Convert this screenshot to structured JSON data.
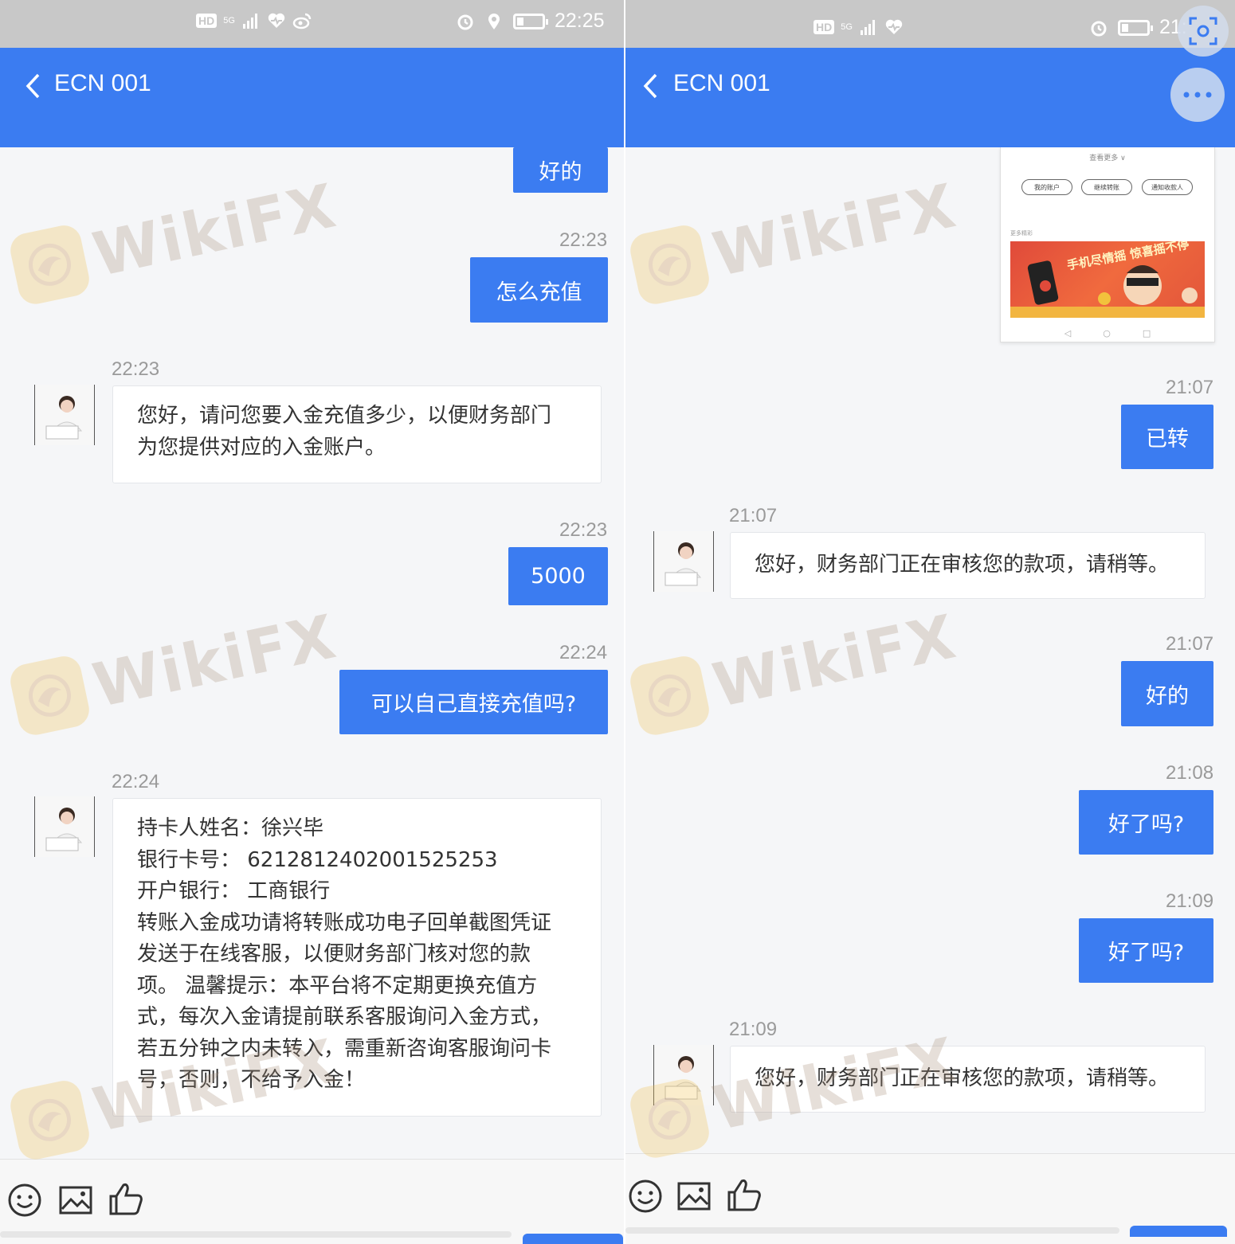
{
  "left": {
    "status_bar": {
      "time": "22:25",
      "badge": "HD",
      "signal": "5G"
    },
    "header": {
      "title": "ECN 001"
    },
    "messages": [
      {
        "type": "out",
        "text": "好的"
      },
      {
        "type": "time",
        "text": "22:23"
      },
      {
        "type": "out",
        "text": "怎么充值"
      },
      {
        "type": "time",
        "text": "22:23"
      },
      {
        "type": "in",
        "lines": [
          "您好，请问您要入金充值多少，以便财务部门",
          "为您提供对应的入金账户。"
        ]
      },
      {
        "type": "time",
        "text": "22:23"
      },
      {
        "type": "out",
        "text": "5000"
      },
      {
        "type": "time",
        "text": "22:24"
      },
      {
        "type": "out",
        "text": "可以自己直接充值吗?"
      },
      {
        "type": "time",
        "text": "22:24"
      },
      {
        "type": "in",
        "lines": [
          "持卡人姓名：徐兴毕",
          "银行卡号： 6212812402001525253",
          "开户银行： 工商银行",
          "转账入金成功请将转账成功电子回单截图凭证",
          "发送于在线客服，以便财务部门核对您的款",
          "项。 温馨提示：本平台将不定期更换充值方",
          "式，每次入金请提前联系客服询问入金方式，",
          "若五分钟之内未转入，需重新咨询客服询问卡",
          "号，否则，不给予入金！"
        ]
      }
    ]
  },
  "right": {
    "status_bar": {
      "time": "21:",
      "badge": "HD",
      "signal": "5G"
    },
    "header": {
      "title": "ECN 001"
    },
    "screenshot": {
      "more_label": "查看更多 ∨",
      "buttons": [
        "我的账户",
        "继续转账",
        "通知收款人"
      ],
      "section_label": "更多精彩",
      "banner_text": "手机尽情摇 惊喜摇不停"
    },
    "messages": [
      {
        "type": "time",
        "text": "21:07"
      },
      {
        "type": "out",
        "text": "已转"
      },
      {
        "type": "time",
        "text": "21:07"
      },
      {
        "type": "in",
        "lines": [
          "您好，财务部门正在审核您的款项，请稍等。"
        ]
      },
      {
        "type": "time",
        "text": "21:07"
      },
      {
        "type": "out",
        "text": "好的"
      },
      {
        "type": "time",
        "text": "21:08"
      },
      {
        "type": "out",
        "text": "好了吗?"
      },
      {
        "type": "time",
        "text": "21:09"
      },
      {
        "type": "out",
        "text": "好了吗?"
      },
      {
        "type": "time",
        "text": "21:09"
      },
      {
        "type": "in",
        "lines": [
          "您好，财务部门正在审核您的款项，请稍等。"
        ]
      }
    ]
  },
  "watermark": "WikiFX",
  "colors": {
    "brand_blue": "#3b7cf1",
    "status_gray": "#c8c8c8",
    "time_gray": "#9a9a9a"
  },
  "icons": {
    "back": "chevron-left-icon",
    "emoji": "smiley-icon",
    "image": "image-icon",
    "like": "thumbs-up-icon",
    "more": "more-dots-icon",
    "screenshot": "screenshot-icon"
  }
}
